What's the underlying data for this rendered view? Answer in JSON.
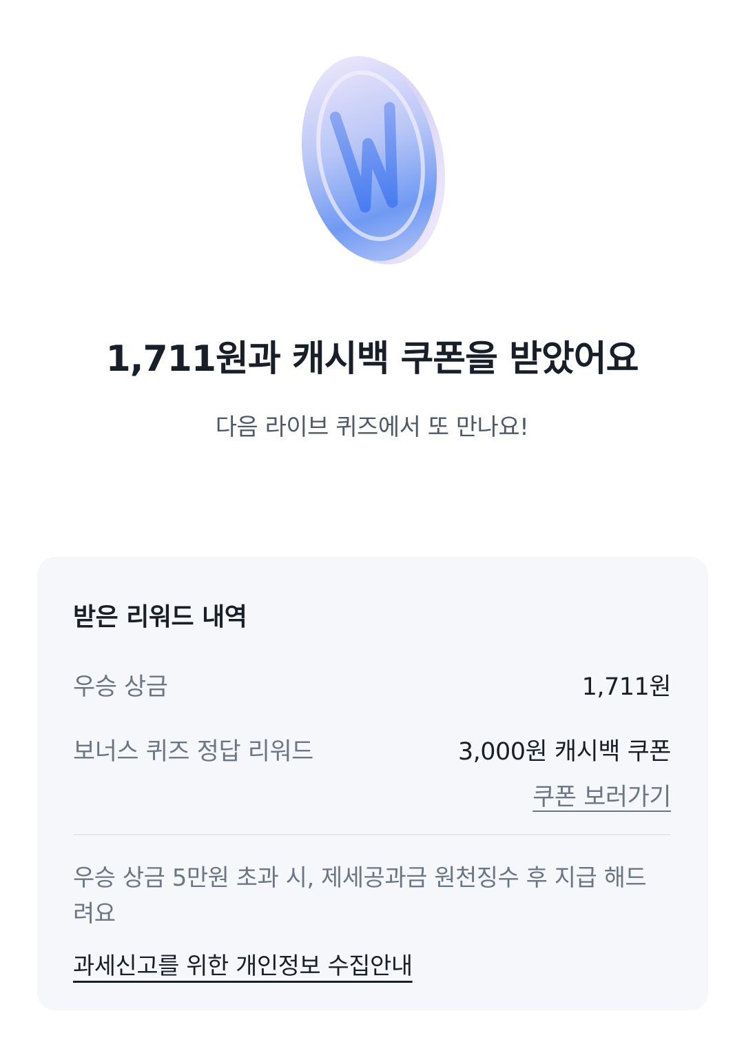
{
  "hero": {
    "icon": "won-coin-icon",
    "title": "1,711원과 캐시백 쿠폰을 받았어요",
    "subtitle": "다음 라이브 퀴즈에서 또 만나요!"
  },
  "rewards": {
    "title": "받은 리워드 내역",
    "items": [
      {
        "label": "우승 상금",
        "value": "1,711원"
      },
      {
        "label": "보너스 퀴즈 정답 리워드",
        "value": "3,000원 캐시백 쿠폰"
      }
    ],
    "coupon_link": "쿠폰 보러가기",
    "notice": "우승 상금 5만원 초과 시, 제세공과금 원천징수 후 지급 해드려요",
    "privacy_link": "과세신고를 위한 개인정보 수집안내"
  },
  "colors": {
    "card_bg": "#f6f7fb",
    "primary_text": "#191f28",
    "secondary_text": "#6b7684",
    "coin_blue": "#4f86f7",
    "coin_lavender": "#e6dcfa"
  }
}
